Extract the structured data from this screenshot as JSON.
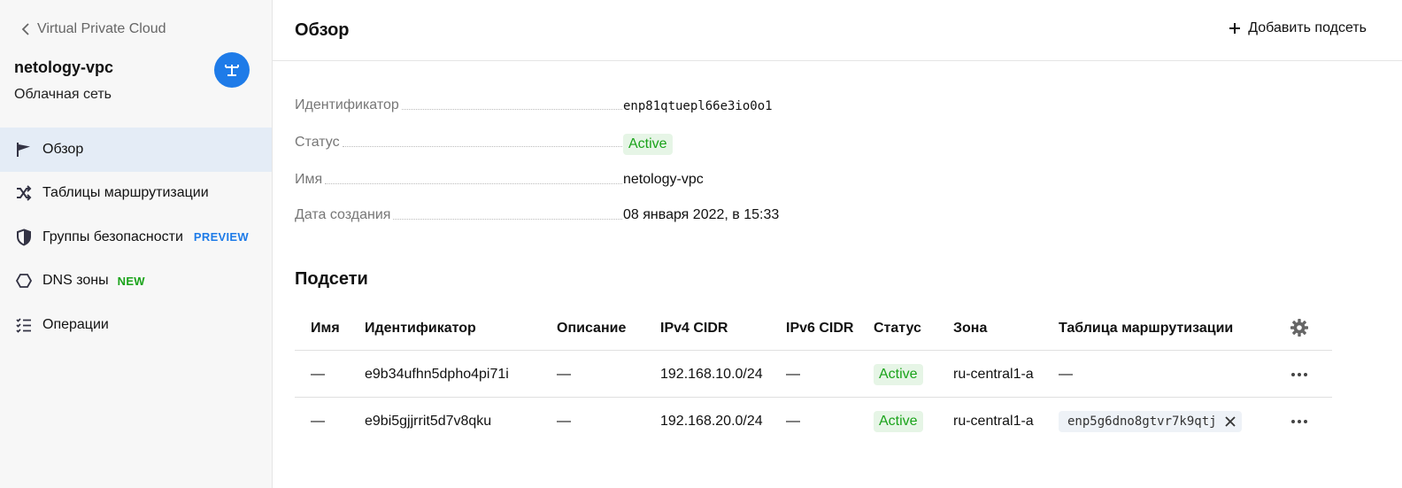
{
  "sidebar": {
    "back_label": "Virtual Private Cloud",
    "title": "netology-vpc",
    "subtitle": "Облачная сеть",
    "items": [
      {
        "label": "Обзор",
        "icon": "flag-icon",
        "active": true
      },
      {
        "label": "Таблицы маршрутизации",
        "icon": "shuffle-icon"
      },
      {
        "label": "Группы безопасности",
        "icon": "shield-icon",
        "badge": "PREVIEW"
      },
      {
        "label": "DNS зоны",
        "icon": "hexagon-icon",
        "badge": "NEW"
      },
      {
        "label": "Операции",
        "icon": "checklist-icon"
      }
    ]
  },
  "header": {
    "title": "Обзор",
    "add_subnet_label": "Добавить подсеть"
  },
  "properties": [
    {
      "label": "Идентификатор",
      "value": "enp81qtuepl66e3io0o1"
    },
    {
      "label": "Статус",
      "value": "Active"
    },
    {
      "label": "Имя",
      "value": "netology-vpc"
    },
    {
      "label": "Дата создания",
      "value": "08 января 2022, в 15:33"
    }
  ],
  "subnets": {
    "title": "Подсети",
    "columns": [
      "Имя",
      "Идентификатор",
      "Описание",
      "IPv4 CIDR",
      "IPv6 CIDR",
      "Статус",
      "Зона",
      "Таблица маршрутизации"
    ],
    "rows": [
      {
        "name": "—",
        "id": "e9b34ufhn5dpho4pi71i",
        "description": "—",
        "ipv4": "192.168.10.0/24",
        "ipv6": "—",
        "status": "Active",
        "zone": "ru-central1-a",
        "route_table": "—"
      },
      {
        "name": "—",
        "id": "e9bi5gjjrrit5d7v8qku",
        "description": "—",
        "ipv4": "192.168.20.0/24",
        "ipv6": "—",
        "status": "Active",
        "zone": "ru-central1-a",
        "route_table": "enp5g6dno8gtvr7k9qtj"
      }
    ]
  },
  "colors": {
    "accent": "#1e7be8",
    "active_nav_bg": "#e4ecf6",
    "status_green": "#1aa31a",
    "status_green_bg": "#e6f5e6"
  }
}
